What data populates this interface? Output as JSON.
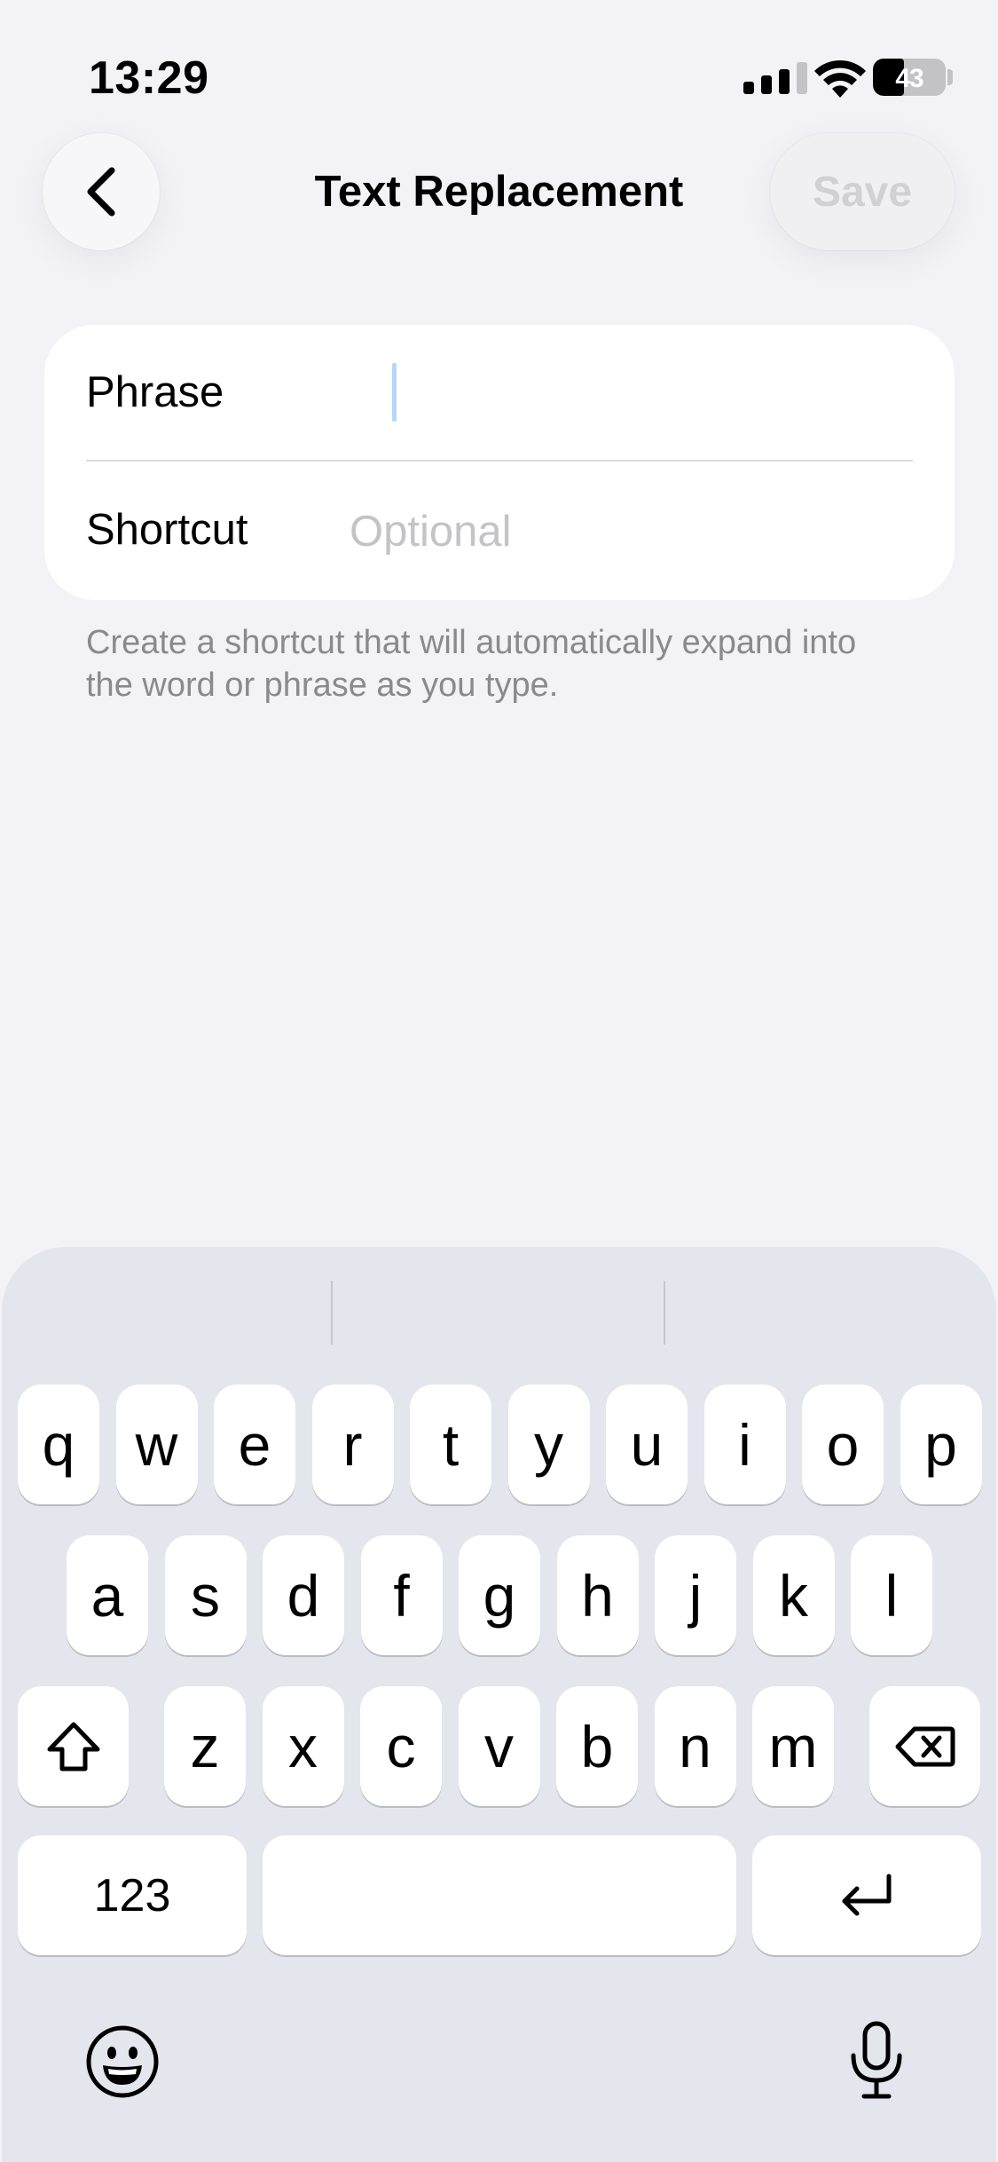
{
  "status_bar": {
    "time": "13:29",
    "battery_percent": "43",
    "battery_level": 0.43
  },
  "nav": {
    "back_icon": "chevron-left-icon",
    "title": "Text Replacement",
    "save_label": "Save",
    "save_enabled": false
  },
  "form": {
    "phrase": {
      "label": "Phrase",
      "value": "",
      "placeholder": ""
    },
    "shortcut": {
      "label": "Shortcut",
      "value": "",
      "placeholder": "Optional"
    }
  },
  "footnote": "Create a shortcut that will automatically expand into the word or phrase as you type.",
  "keyboard": {
    "row1": [
      "q",
      "w",
      "e",
      "r",
      "t",
      "y",
      "u",
      "i",
      "o",
      "p"
    ],
    "row2": [
      "a",
      "s",
      "d",
      "f",
      "g",
      "h",
      "j",
      "k",
      "l"
    ],
    "row3": [
      "z",
      "x",
      "c",
      "v",
      "b",
      "n",
      "m"
    ],
    "numbers_label": "123",
    "space_label": "",
    "icons": {
      "shift": "shift-icon",
      "delete": "delete-icon",
      "return": "return-icon",
      "emoji": "emoji-icon",
      "dictation": "microphone-icon"
    }
  },
  "colors": {
    "background": "#f2f2f7",
    "keyboard_background": "#e4e6ee",
    "caret": "#b4d9f5",
    "disabled_text": "#d0d0d5",
    "secondary_text": "#8a8a8e"
  }
}
